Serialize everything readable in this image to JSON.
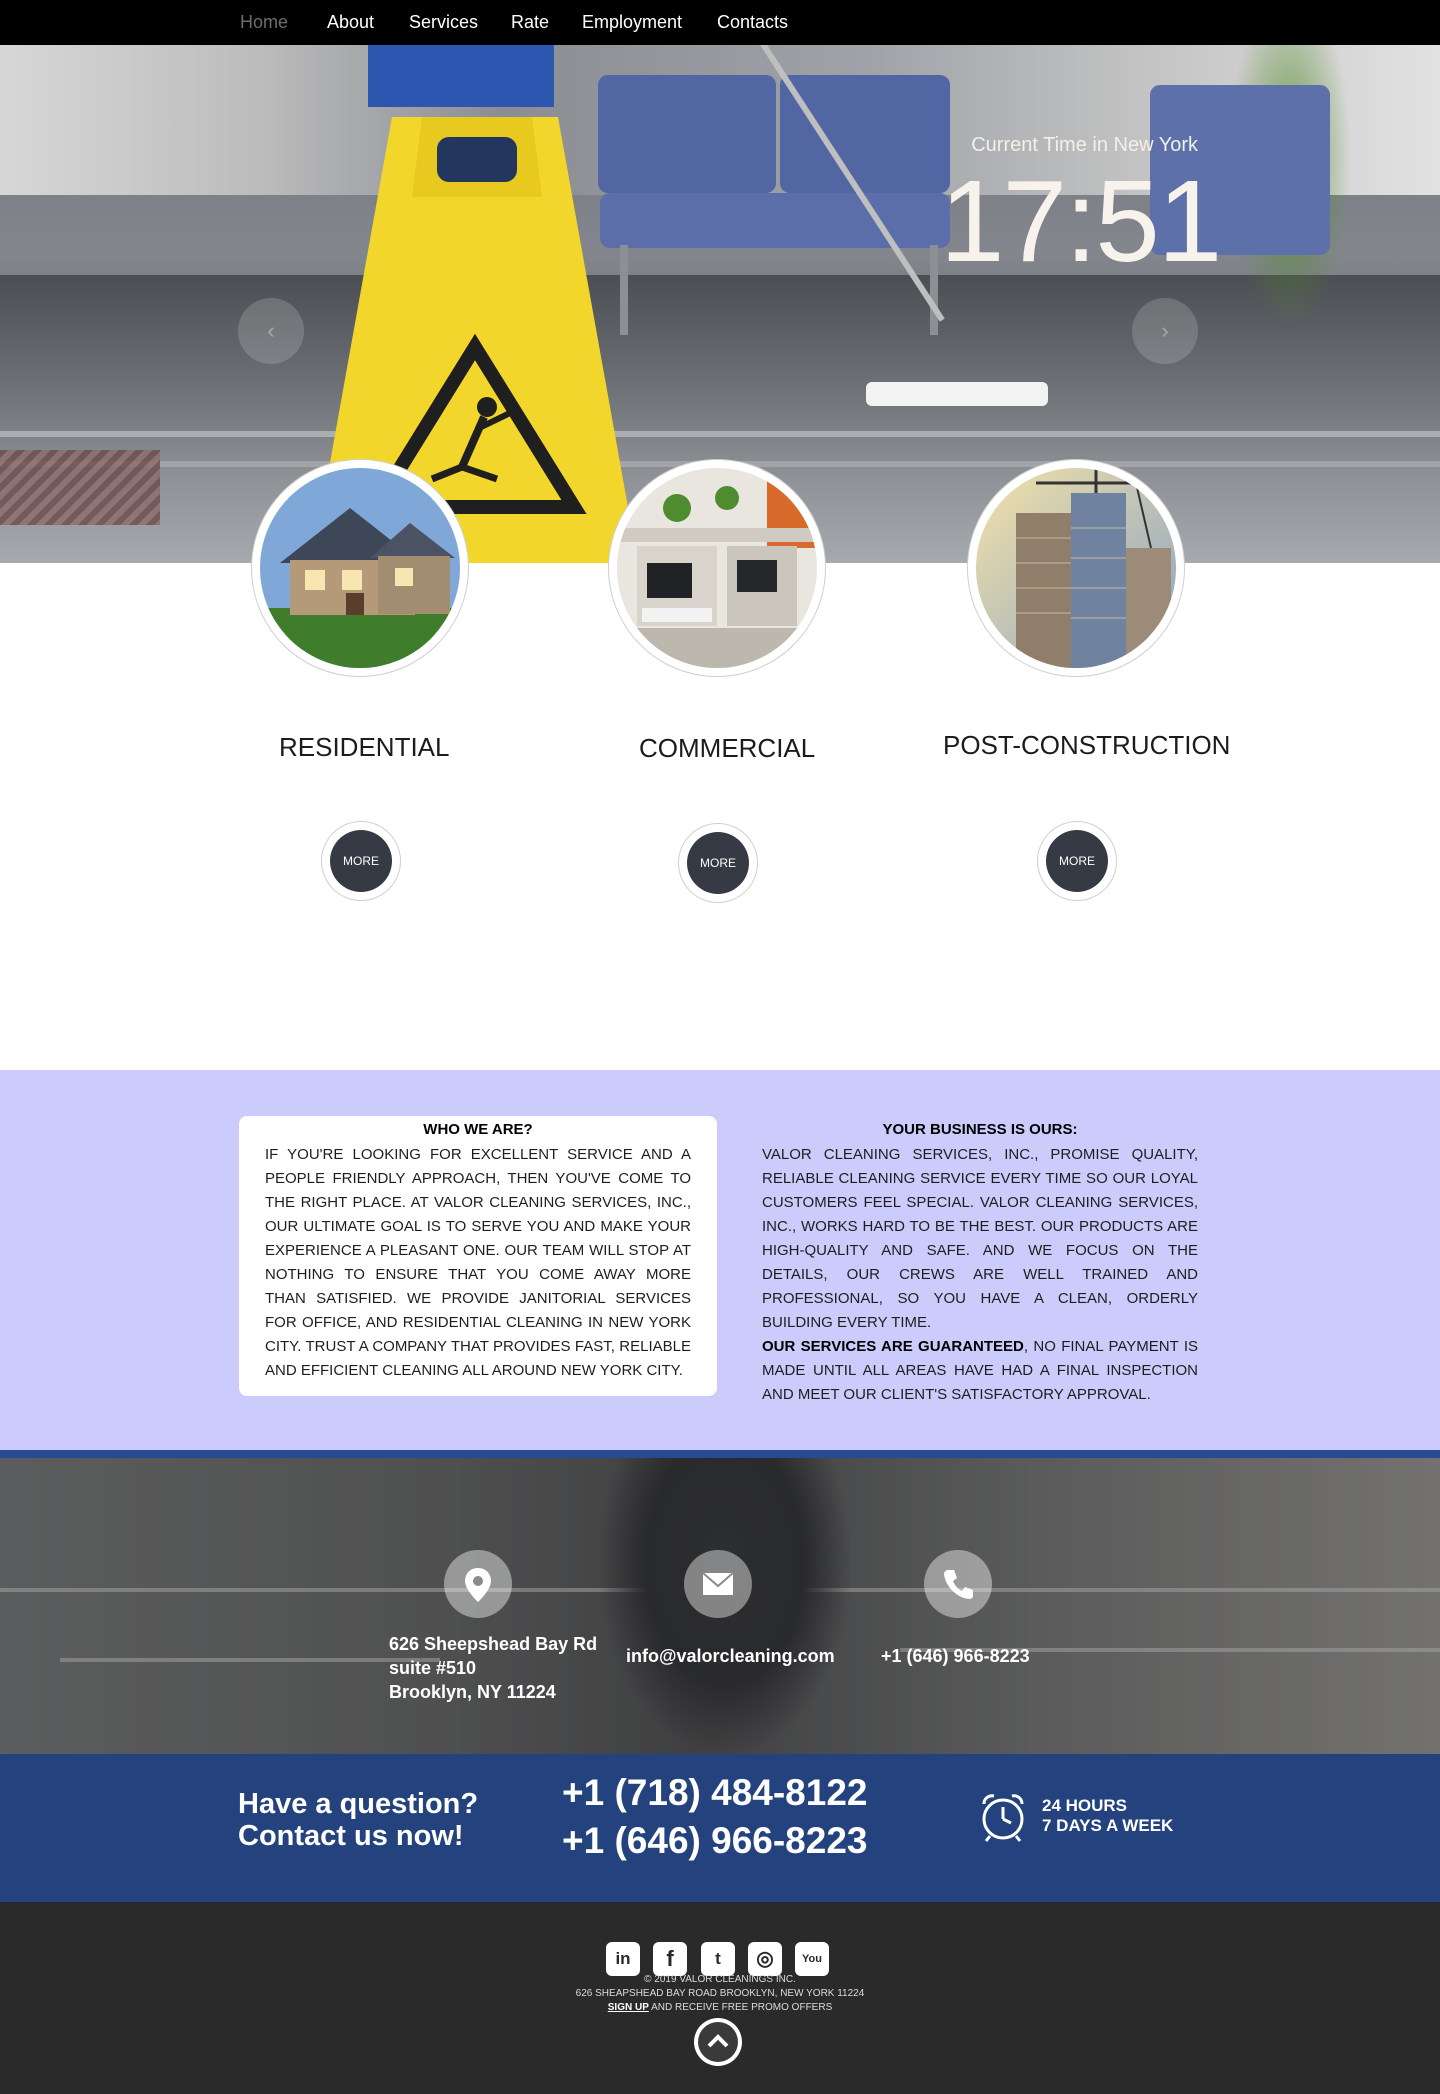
{
  "nav": {
    "items": [
      {
        "label": "Home",
        "active": true
      },
      {
        "label": "About"
      },
      {
        "label": "Services"
      },
      {
        "label": "Rate"
      },
      {
        "label": "Employment"
      },
      {
        "label": "Contacts"
      }
    ]
  },
  "hero": {
    "clock_label": "Current Time in New York",
    "clock_time": "17:51",
    "prev_icon": "chevron-left-icon",
    "next_icon": "chevron-right-icon"
  },
  "services": [
    {
      "title": "RESIDENTIAL",
      "more_label": "MORE"
    },
    {
      "title": "COMMERCIAL",
      "more_label": "MORE"
    },
    {
      "title": "POST-CONSTRUCTION",
      "more_label": "MORE"
    }
  ],
  "about": {
    "who_heading": "WHO WE ARE?",
    "who_body": "IF YOU'RE LOOKING FOR EXCELLENT SERVICE AND A PEOPLE FRIENDLY APPROACH, THEN YOU'VE COME TO THE RIGHT PLACE. AT VALOR CLEANING SERVICES, INC., OUR ULTIMATE GOAL IS TO SERVE YOU AND MAKE YOUR EXPERIENCE A PLEASANT ONE. OUR TEAM WILL STOP AT NOTHING TO ENSURE THAT YOU COME AWAY MORE THAN SATISFIED. WE PROVIDE JANITORIAL SERVICES FOR OFFICE, AND RESIDENTIAL CLEANING IN NEW YORK CITY. TRUST A COMPANY THAT PROVIDES FAST, RELIABLE AND EFFICIENT CLEANING ALL AROUND NEW YORK CITY.",
    "business_heading": "YOUR BUSINESS IS OURS:",
    "business_body": "VALOR CLEANING SERVICES, INC., PROMISE QUALITY, RELIABLE CLEANING SERVICE EVERY TIME SO OUR LOYAL CUSTOMERS FEEL SPECIAL. VALOR CLEANING SERVICES, INC., WORKS HARD TO BE THE BEST. OUR PRODUCTS ARE HIGH-QUALITY AND SAFE. AND WE FOCUS ON THE DETAILS, OUR CREWS ARE WELL TRAINED AND PROFESSIONAL, SO YOU HAVE A CLEAN, ORDERLY BUILDING EVERY TIME.",
    "guarantee_bold": "OUR SERVICES ARE GUARANTEED",
    "guarantee_rest": ", NO FINAL PAYMENT IS MADE UNTIL ALL AREAS HAVE HAD A FINAL INSPECTION AND MEET OUR CLIENT'S SATISFACTORY APPROVAL."
  },
  "contact": {
    "address_line1": "626 Sheepshead Bay Rd",
    "address_line2": "suite #510",
    "address_line3": "Brooklyn, NY 11224",
    "email": "info@valorcleaning.com",
    "phone": "+1 (646) 966-8223",
    "icons": [
      "map-pin-icon",
      "envelope-icon",
      "phone-icon"
    ]
  },
  "cta": {
    "question_line1": "Have a question?",
    "question_line2": "Contact us  now!",
    "phone1": "+1 (718) 484-8122",
    "phone2": "+1 (646) 966-8223",
    "hours_line1": "24 HOURS",
    "hours_line2": "7 DAYS A WEEK",
    "icon": "alarm-clock-icon"
  },
  "footer": {
    "social": [
      {
        "label": "in",
        "icon": "linkedin-icon"
      },
      {
        "label": "f",
        "icon": "facebook-icon"
      },
      {
        "label": "t",
        "icon": "twitter-icon"
      },
      {
        "label": "◎",
        "icon": "instagram-icon"
      },
      {
        "label": "You",
        "icon": "youtube-icon"
      }
    ],
    "copyright": "© 2019  VALOR CLEANINGS INC.",
    "address": "626 SHEAPSHEAD BAY ROAD BROOKLYN, NEW YORK 11224",
    "signup_link": "SIGN UP",
    "signup_rest": " AND RECEIVE FREE PROMO OFFERS"
  },
  "colors": {
    "nav_bg": "#000000",
    "about_bg": "#cbcbfc",
    "cta_bg": "#24437e",
    "footer_bg": "#2a2a2a",
    "button_dark": "#363a44"
  }
}
